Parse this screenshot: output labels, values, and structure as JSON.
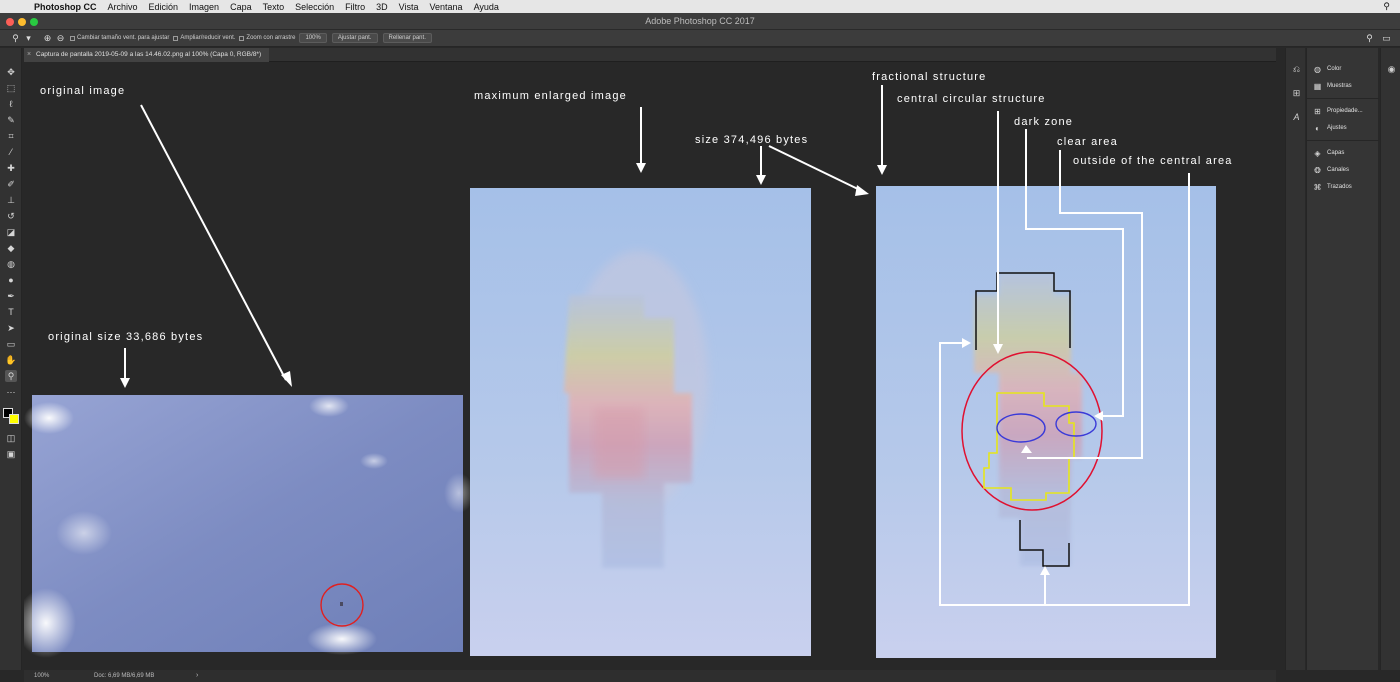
{
  "menubar": {
    "app_name": "Photoshop CC",
    "items": [
      "Archivo",
      "Edición",
      "Imagen",
      "Capa",
      "Texto",
      "Selección",
      "Filtro",
      "3D",
      "Vista",
      "Ventana",
      "Ayuda"
    ]
  },
  "window": {
    "title": "Adobe Photoshop CC 2017"
  },
  "options_bar": {
    "resize_windows_label": "Cambiar tamaño vent. para ajustar",
    "zoom_all_label": "Ampliar/reducir vent.",
    "scrubby_zoom_label": "Zoom con arrastre",
    "zoom_percent": "100%",
    "fit_screen_label": "Ajustar pant.",
    "fill_screen_label": "Rellenar pant."
  },
  "document": {
    "tab_title": "Captura de pantalla 2019-05-09 a las 14.46.02.png al 100% (Capa 0, RGB/8*)"
  },
  "status": {
    "zoom": "100%",
    "doc_info": "Doc: 6,69 MB/6,69 MB"
  },
  "panels": {
    "group1": [
      "Color",
      "Muestras"
    ],
    "group2": [
      "Propiedade...",
      "Ajustes"
    ],
    "group3": [
      "Capas",
      "Canales",
      "Trazados"
    ]
  },
  "annotations": {
    "original_image": "original image",
    "original_size": "original size 33,686 bytes",
    "max_enlarged": "maximum enlarged image",
    "size": "size 374,496 bytes",
    "fractional": "fractional structure",
    "central_circular": "central circular structure",
    "dark_zone": "dark zone",
    "clear_area": "clear area",
    "outside": "outside of the central area"
  },
  "colors": {
    "sky_original": "#7f8fc0",
    "sky_enlarged": "#a9c2e6",
    "annotation_text": "#ffffff",
    "circle_marker": "#e02020",
    "yellow_outline": "#e6e61a",
    "blue_ellipse": "#3a3ad8",
    "foreground_swatch": "#000000",
    "background_swatch": "#ffff00"
  }
}
